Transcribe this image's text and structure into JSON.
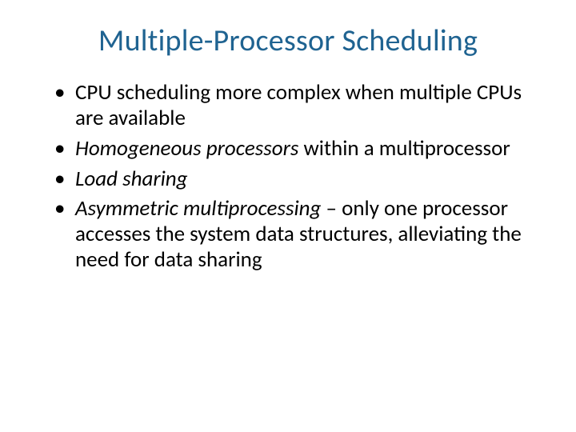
{
  "title": "Multiple-Processor Scheduling",
  "bullets": {
    "b1": "CPU scheduling more complex when multiple CPUs are available",
    "b2a": "Homogeneous processors",
    "b2b": " within a multiprocessor",
    "b3": "Load sharing",
    "b4a": "Asymmetric multiprocessing",
    "b4b": " – only one processor accesses the system data structures, alleviating the need for data sharing"
  }
}
